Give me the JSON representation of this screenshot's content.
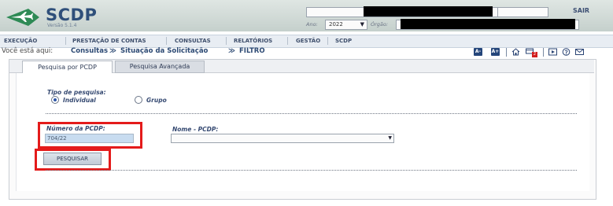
{
  "header": {
    "brand": "SCDP",
    "version": "Versão 5.1.4",
    "logout_label": "SAIR",
    "year_label": "Ano:",
    "year_value": "2022",
    "org_label": "Órgão:"
  },
  "menu": [
    "EXECUÇÃO",
    "PRESTAÇÃO DE CONTAS",
    "CONSULTAS",
    "RELATÓRIOS",
    "GESTÃO",
    "SCDP"
  ],
  "breadcrumb": {
    "label": "Você está aqui:",
    "items": [
      "Consultas",
      "Situação da Solicitação",
      "FILTRO"
    ],
    "separator": "≫"
  },
  "toolbar": {
    "font_decrease": "A-",
    "font_increase": "A+",
    "notification_count": "2"
  },
  "tabs": [
    "Pesquisa por PCDP",
    "Pesquisa Avançada"
  ],
  "form": {
    "search_type_label": "Tipo de pesquisa:",
    "option_individual": "Individual",
    "option_group": "Grupo",
    "selected_option": "Individual",
    "pcdp_number_label": "Número da PCDP:",
    "pcdp_number_value": "704/22",
    "name_label": "Nome - PCDP:",
    "name_value": "",
    "search_button": "PESQUISAR"
  },
  "colors": {
    "brand": "#2f4f7a",
    "highlight": "#e41b1b",
    "input_bg": "#c8dcf0"
  }
}
